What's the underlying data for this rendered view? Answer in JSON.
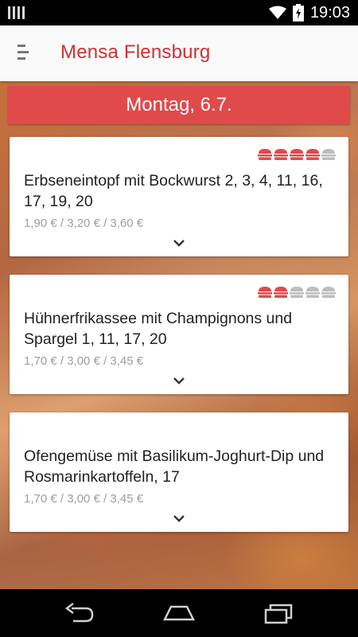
{
  "status_bar": {
    "time": "19:03",
    "icons": [
      "signal-bars-icon",
      "wifi-icon",
      "battery-charging-icon"
    ]
  },
  "app_bar": {
    "title": "Mensa Flensburg",
    "menu_icon": "hamburger-menu-icon"
  },
  "day": "Montag, 6.7.",
  "colors": {
    "accent": "#d32f2f",
    "banner": "#e04a4a",
    "rating_active": "#e04a4a",
    "rating_inactive": "#bdbdbd",
    "price_text": "#9e9e9e"
  },
  "meals": [
    {
      "name": "Erbseneintopf mit Bockwurst 2, 3, 4, 11, 16, 17, 19, 20",
      "price": "1,90 € / 3,20 € / 3,60 €",
      "rating": 4,
      "rating_max": 5
    },
    {
      "name": "Hühnerfrikassee mit Champignons und Spargel 1, 11, 17, 20",
      "price": "1,70 € / 3,00 € / 3,45 €",
      "rating": 2,
      "rating_max": 5
    },
    {
      "name": "Ofengemüse mit Basilikum-Joghurt-Dip und Rosmarinkartoffeln, 17",
      "price": "1,70 € / 3,00 € / 3,45 €",
      "rating": null,
      "rating_max": 5
    }
  ],
  "nav_bar": {
    "buttons": [
      "back-icon",
      "home-icon",
      "recent-apps-icon"
    ]
  }
}
